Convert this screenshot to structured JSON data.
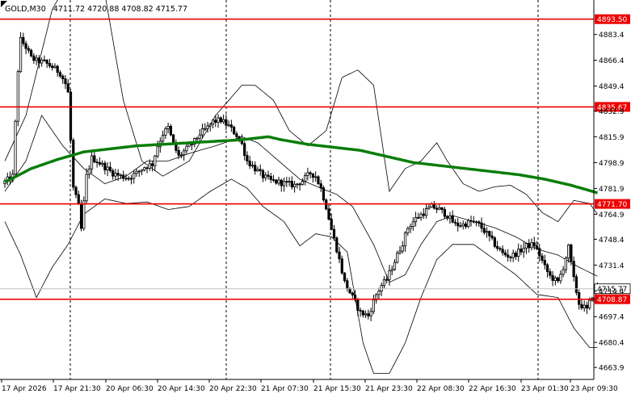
{
  "header": {
    "symbol_timeframe": "GOLD,M30",
    "ohlc": "4711.72 4720.88 4708.82 4715.77"
  },
  "chart_data": {
    "type": "candlestick",
    "symbol": "GOLD",
    "timeframe": "M30",
    "ylim": [
      4656,
      4904
    ],
    "y_ticks": [
      "4883.4",
      "4866.4",
      "4849.4",
      "4832.9",
      "4815.9",
      "4798.9",
      "4781.9",
      "4764.9",
      "4748.4",
      "4731.4",
      "4714.4",
      "4697.4",
      "4680.4",
      "4663.9"
    ],
    "x_ticks": [
      "17 Apr 2026",
      "17 Apr 21:30",
      "20 Apr 06:30",
      "20 Apr 14:30",
      "20 Apr 22:30",
      "21 Apr 07:30",
      "21 Apr 15:30",
      "21 Apr 23:30",
      "22 Apr 08:30",
      "22 Apr 16:30",
      "23 Apr 01:30",
      "23 Apr 09:30"
    ],
    "session_separators": [
      "17 Apr 21:30",
      "20 Apr 22:30",
      "21 Apr 15:30",
      "23 Apr 01:30"
    ],
    "levels": [
      {
        "value": 4893.5,
        "label": "4893.50"
      },
      {
        "value": 4835.67,
        "label": "4835.67"
      },
      {
        "value": 4771.7,
        "label": "4771.70"
      },
      {
        "value": 4708.87,
        "label": "4708.87"
      }
    ],
    "current_price": {
      "value": 4715.77,
      "label": "4715.77"
    },
    "ma_series": [
      [
        0,
        4786
      ],
      [
        10,
        4795
      ],
      [
        20,
        4801
      ],
      [
        30,
        4806
      ],
      [
        40,
        4808
      ],
      [
        50,
        4810
      ],
      [
        60,
        4811
      ],
      [
        70,
        4812
      ],
      [
        80,
        4813
      ],
      [
        90,
        4814
      ],
      [
        100,
        4816
      ],
      [
        105,
        4814
      ],
      [
        115,
        4811
      ],
      [
        125,
        4809
      ],
      [
        135,
        4807
      ],
      [
        145,
        4803
      ],
      [
        155,
        4799
      ],
      [
        165,
        4797
      ],
      [
        175,
        4795
      ],
      [
        185,
        4793
      ],
      [
        195,
        4791
      ],
      [
        205,
        4788
      ],
      [
        215,
        4784
      ],
      [
        225,
        4779
      ]
    ],
    "bollinger": {
      "upper": [
        [
          0,
          4800
        ],
        [
          8,
          4830
        ],
        [
          18,
          4900
        ],
        [
          28,
          4930
        ],
        [
          38,
          4910
        ],
        [
          45,
          4840
        ],
        [
          52,
          4800
        ],
        [
          60,
          4790
        ],
        [
          70,
          4800
        ],
        [
          80,
          4830
        ],
        [
          90,
          4850
        ],
        [
          95,
          4850
        ],
        [
          102,
          4840
        ],
        [
          108,
          4820
        ],
        [
          115,
          4810
        ],
        [
          122,
          4820
        ],
        [
          128,
          4855
        ],
        [
          134,
          4860
        ],
        [
          140,
          4850
        ],
        [
          146,
          4780
        ],
        [
          152,
          4795
        ],
        [
          158,
          4800
        ],
        [
          164,
          4812
        ],
        [
          168,
          4800
        ],
        [
          174,
          4785
        ],
        [
          180,
          4780
        ],
        [
          186,
          4783
        ],
        [
          192,
          4784
        ],
        [
          198,
          4778
        ],
        [
          204,
          4766
        ],
        [
          210,
          4760
        ],
        [
          216,
          4774
        ],
        [
          222,
          4772
        ],
        [
          225,
          4765
        ]
      ],
      "middle": [
        [
          0,
          4780
        ],
        [
          8,
          4800
        ],
        [
          14,
          4830
        ],
        [
          22,
          4810
        ],
        [
          30,
          4795
        ],
        [
          38,
          4785
        ],
        [
          46,
          4790
        ],
        [
          54,
          4800
        ],
        [
          62,
          4800
        ],
        [
          70,
          4805
        ],
        [
          80,
          4810
        ],
        [
          90,
          4816
        ],
        [
          96,
          4812
        ],
        [
          104,
          4800
        ],
        [
          112,
          4788
        ],
        [
          120,
          4782
        ],
        [
          126,
          4778
        ],
        [
          132,
          4770
        ],
        [
          140,
          4745
        ],
        [
          146,
          4720
        ],
        [
          152,
          4725
        ],
        [
          158,
          4745
        ],
        [
          164,
          4760
        ],
        [
          170,
          4764
        ],
        [
          178,
          4760
        ],
        [
          186,
          4756
        ],
        [
          194,
          4750
        ],
        [
          202,
          4742
        ],
        [
          210,
          4738
        ],
        [
          218,
          4730
        ],
        [
          225,
          4724
        ]
      ],
      "lower": [
        [
          0,
          4760
        ],
        [
          6,
          4738
        ],
        [
          12,
          4710
        ],
        [
          18,
          4730
        ],
        [
          24,
          4745
        ],
        [
          30,
          4765
        ],
        [
          38,
          4775
        ],
        [
          46,
          4772
        ],
        [
          54,
          4773
        ],
        [
          62,
          4768
        ],
        [
          70,
          4770
        ],
        [
          78,
          4780
        ],
        [
          86,
          4788
        ],
        [
          92,
          4782
        ],
        [
          98,
          4770
        ],
        [
          106,
          4760
        ],
        [
          112,
          4744
        ],
        [
          118,
          4752
        ],
        [
          124,
          4750
        ],
        [
          130,
          4740
        ],
        [
          136,
          4680
        ],
        [
          140,
          4660
        ],
        [
          146,
          4660
        ],
        [
          152,
          4680
        ],
        [
          158,
          4710
        ],
        [
          164,
          4735
        ],
        [
          170,
          4745
        ],
        [
          178,
          4745
        ],
        [
          186,
          4735
        ],
        [
          194,
          4725
        ],
        [
          202,
          4712
        ],
        [
          210,
          4710
        ],
        [
          216,
          4690
        ],
        [
          222,
          4677
        ],
        [
          225,
          4677
        ]
      ]
    },
    "candle_path": [
      [
        0,
        4785
      ],
      [
        4,
        4790
      ],
      [
        6,
        4860
      ],
      [
        7,
        4880
      ],
      [
        9,
        4875
      ],
      [
        11,
        4868
      ],
      [
        13,
        4866
      ],
      [
        16,
        4865
      ],
      [
        19,
        4862
      ],
      [
        22,
        4858
      ],
      [
        24,
        4851
      ],
      [
        25,
        4845
      ],
      [
        27,
        4782
      ],
      [
        29,
        4770
      ],
      [
        30,
        4755
      ],
      [
        32,
        4790
      ],
      [
        34,
        4802
      ],
      [
        36,
        4800
      ],
      [
        39,
        4796
      ],
      [
        42,
        4792
      ],
      [
        45,
        4790
      ],
      [
        48,
        4789
      ],
      [
        51,
        4792
      ],
      [
        54,
        4796
      ],
      [
        57,
        4798
      ],
      [
        59,
        4810
      ],
      [
        61,
        4818
      ],
      [
        63,
        4822
      ],
      [
        65,
        4811
      ],
      [
        67,
        4803
      ],
      [
        70,
        4808
      ],
      [
        73,
        4813
      ],
      [
        75,
        4818
      ],
      [
        78,
        4822
      ],
      [
        80,
        4826
      ],
      [
        83,
        4827
      ],
      [
        86,
        4823
      ],
      [
        89,
        4817
      ],
      [
        91,
        4811
      ],
      [
        93,
        4800
      ],
      [
        96,
        4795
      ],
      [
        99,
        4790
      ],
      [
        102,
        4787
      ],
      [
        105,
        4786
      ],
      [
        108,
        4785
      ],
      [
        111,
        4784
      ],
      [
        114,
        4787
      ],
      [
        117,
        4792
      ],
      [
        119,
        4790
      ],
      [
        121,
        4782
      ],
      [
        123,
        4770
      ],
      [
        125,
        4755
      ],
      [
        127,
        4742
      ],
      [
        130,
        4720
      ],
      [
        133,
        4710
      ],
      [
        136,
        4700
      ],
      [
        139,
        4698
      ],
      [
        142,
        4712
      ],
      [
        144,
        4718
      ],
      [
        146,
        4722
      ],
      [
        148,
        4730
      ],
      [
        150,
        4738
      ],
      [
        152,
        4746
      ],
      [
        154,
        4756
      ],
      [
        157,
        4762
      ],
      [
        160,
        4766
      ],
      [
        163,
        4770
      ],
      [
        166,
        4768
      ],
      [
        169,
        4764
      ],
      [
        172,
        4758
      ],
      [
        175,
        4758
      ],
      [
        178,
        4760
      ],
      [
        181,
        4758
      ],
      [
        184,
        4752
      ],
      [
        187,
        4745
      ],
      [
        190,
        4739
      ],
      [
        193,
        4737
      ],
      [
        196,
        4740
      ],
      [
        199,
        4744
      ],
      [
        202,
        4745
      ],
      [
        204,
        4738
      ],
      [
        206,
        4730
      ],
      [
        208,
        4724
      ],
      [
        211,
        4720
      ],
      [
        213,
        4730
      ],
      [
        215,
        4743
      ],
      [
        217,
        4722
      ],
      [
        219,
        4706
      ],
      [
        222,
        4702
      ],
      [
        225,
        4716
      ]
    ]
  }
}
